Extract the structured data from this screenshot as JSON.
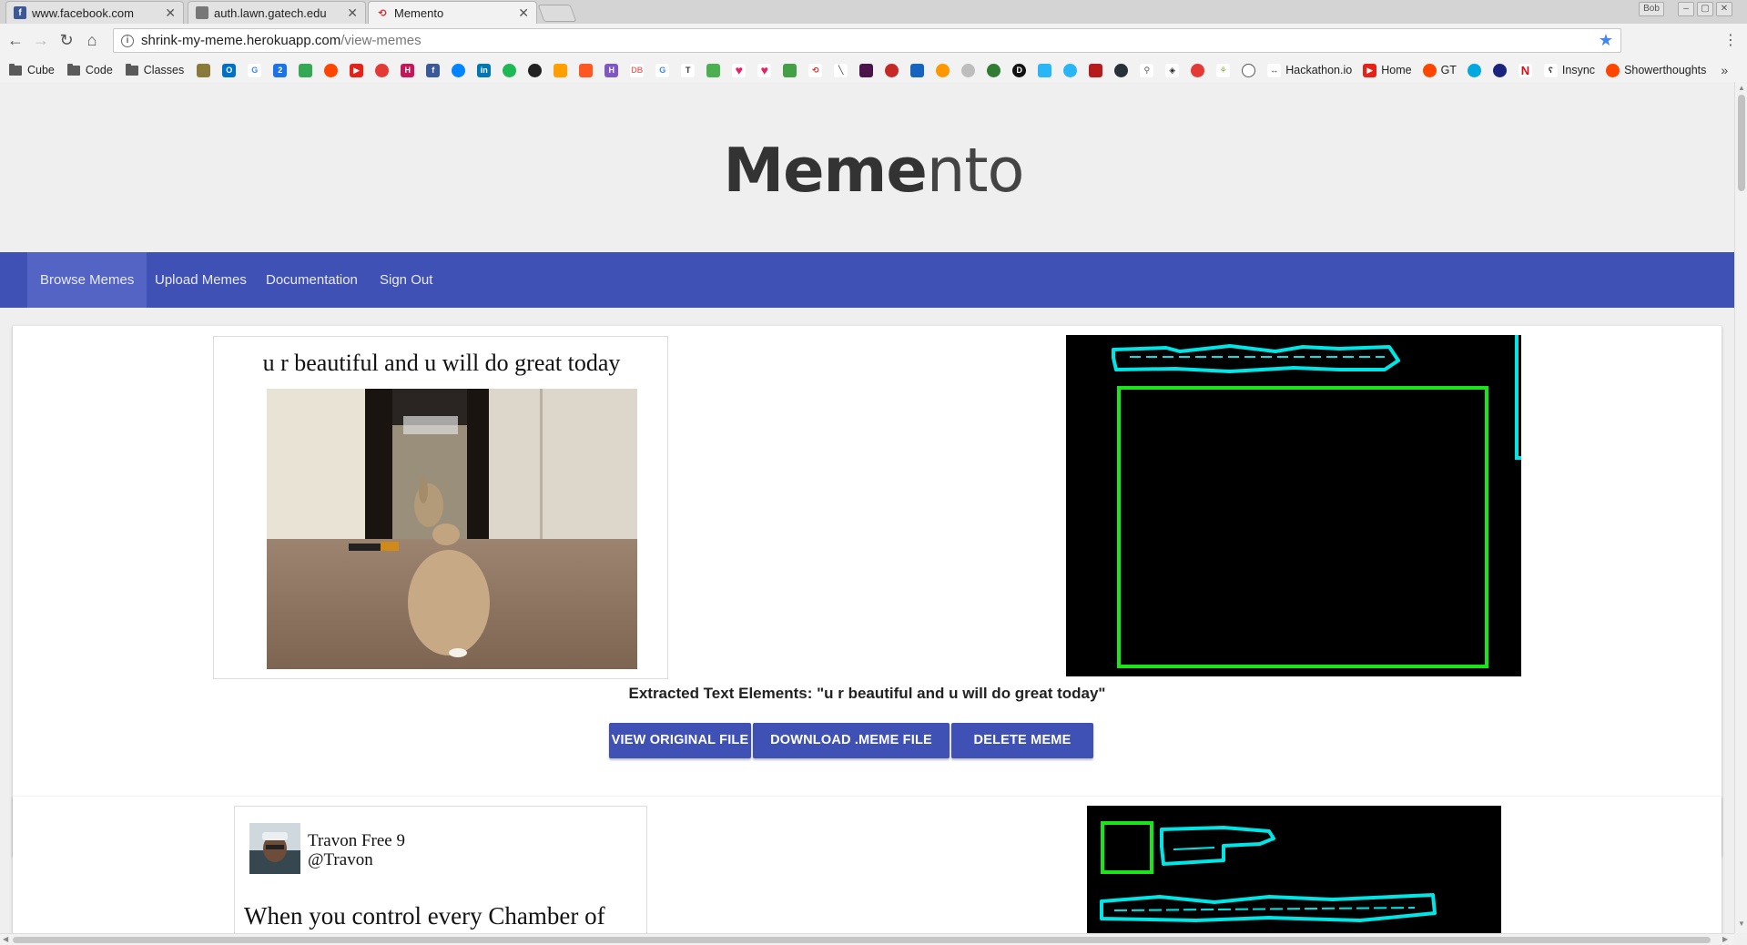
{
  "browser": {
    "tabs": [
      {
        "title": "www.facebook.com",
        "icon": "facebook-icon",
        "color": "#3b5998",
        "active": false
      },
      {
        "title": "auth.lawn.gatech.edu",
        "icon": "raccoon-icon",
        "color": "#777777",
        "active": false
      },
      {
        "title": "Memento",
        "icon": "memento-icon",
        "color": "#d32f2f",
        "active": true
      }
    ],
    "url_host": "shrink-my-meme.herokuapp.com",
    "url_path": "/view-memes",
    "profile_label": "Bob",
    "bookmarks": {
      "folders": [
        "Cube",
        "Code",
        "Classes"
      ],
      "text_items": [
        "Hackathon.io",
        "Home",
        "GT",
        "Insync",
        "Showerthoughts"
      ]
    }
  },
  "site": {
    "title_bold": "Meme",
    "title_light": "nto",
    "nav": [
      "Browse Memes",
      "Upload Memes",
      "Documentation",
      "Sign Out"
    ],
    "accent": "#3f51b5"
  },
  "memes": [
    {
      "caption": "u r beautiful and u will do great today",
      "extracted_label": "Extracted Text Elements: \"u r beautiful and u will do great today\"",
      "buttons": [
        "VIEW ORIGINAL FILE",
        "DOWNLOAD .MEME FILE",
        "DELETE MEME"
      ]
    },
    {
      "tweet_name": "Travon Free 9",
      "tweet_handle": "@Travon",
      "tweet_text": "When you control every Chamber of"
    }
  ]
}
